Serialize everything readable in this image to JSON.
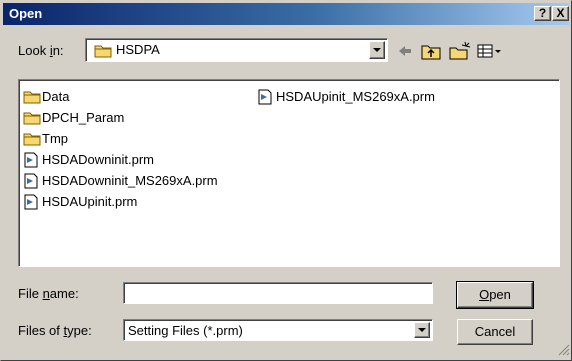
{
  "window": {
    "title": "Open",
    "help_button": "?",
    "close_button": "X"
  },
  "lookin": {
    "label_pre": "Look ",
    "label_u": "i",
    "label_post": "n:",
    "value": "HSDPA"
  },
  "toolbar": {
    "icons": [
      "back-icon",
      "up-folder-icon",
      "new-folder-icon",
      "view-menu-icon"
    ]
  },
  "files": {
    "column1": [
      {
        "name": "Data",
        "type": "folder"
      },
      {
        "name": "DPCH_Param",
        "type": "folder"
      },
      {
        "name": "Tmp",
        "type": "folder"
      },
      {
        "name": "HSDADowninit.prm",
        "type": "file"
      },
      {
        "name": "HSDADowninit_MS269xA.prm",
        "type": "file"
      },
      {
        "name": "HSDAUpinit.prm",
        "type": "file"
      }
    ],
    "column2": [
      {
        "name": "HSDAUpinit_MS269xA.prm",
        "type": "file"
      }
    ]
  },
  "filename": {
    "label_pre": "File ",
    "label_u": "n",
    "label_post": "ame:",
    "value": ""
  },
  "filetype": {
    "label_pre": "Files of ",
    "label_u": "t",
    "label_post": "ype:",
    "value": "Setting Files (*.prm)"
  },
  "buttons": {
    "open_u": "O",
    "open_rest": "pen",
    "cancel": "Cancel"
  },
  "colors": {
    "title_start": "#0a246a",
    "title_end": "#a6caf0",
    "face": "#d4d0c8",
    "folder": "#f7d772"
  }
}
